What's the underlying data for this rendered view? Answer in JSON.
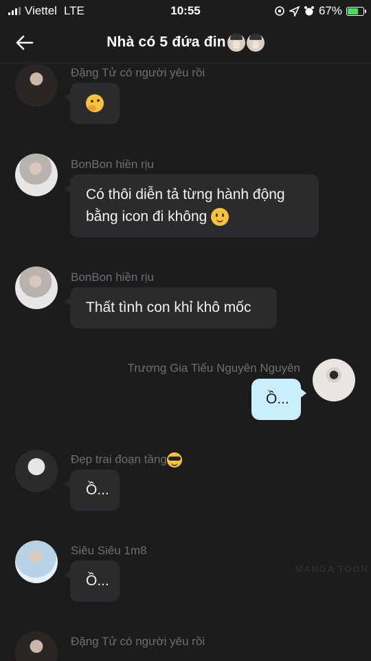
{
  "status_bar": {
    "carrier": "Viettel",
    "network": "LTE",
    "time": "10:55",
    "battery": "67%",
    "battery_level": 0.67
  },
  "nav": {
    "title": "Nhà có 5 đứa đin",
    "title_emoji": "face-palm-emoji"
  },
  "messages": [
    {
      "side": "left",
      "sender": "Đặng Tử có người yêu rồi",
      "text": "",
      "emoji": "thinking-face-emoji",
      "avatar": "dark"
    },
    {
      "side": "left",
      "sender": "BonBon hiền rịu",
      "lines": [
        "Có thôi diễn tả từng hành động",
        "bằng icon đi không"
      ],
      "emoji": "slightly-smiling-face-emoji",
      "avatar": "light"
    },
    {
      "side": "left",
      "sender": "BonBon hiền rịu",
      "text": "Thất tình con khỉ khô mốc",
      "avatar": "light"
    },
    {
      "side": "right",
      "sender": "Trương Gia Tiểu Nguyên Nguyên",
      "text": "Ồ...",
      "avatar": "mask"
    },
    {
      "side": "left",
      "sender": "Đẹp trai đoạn tầng",
      "sender_emoji": "cool-sunglasses-emoji",
      "text": "Ồ...",
      "avatar": "white"
    },
    {
      "side": "left",
      "sender": "Siêu Siêu 1m8",
      "text": "Ồ...",
      "avatar": "blue"
    },
    {
      "side": "left",
      "sender": "Đặng Tử có người yêu rồi",
      "text": "",
      "avatar": "dark"
    }
  ],
  "watermark": "MANGA TOON",
  "colors": {
    "background": "#1c1c1d",
    "bubble_left": "#2b2b2d",
    "bubble_right": "#cbeefd",
    "sender_text": "#6e6e73",
    "battery": "#4cd964"
  }
}
